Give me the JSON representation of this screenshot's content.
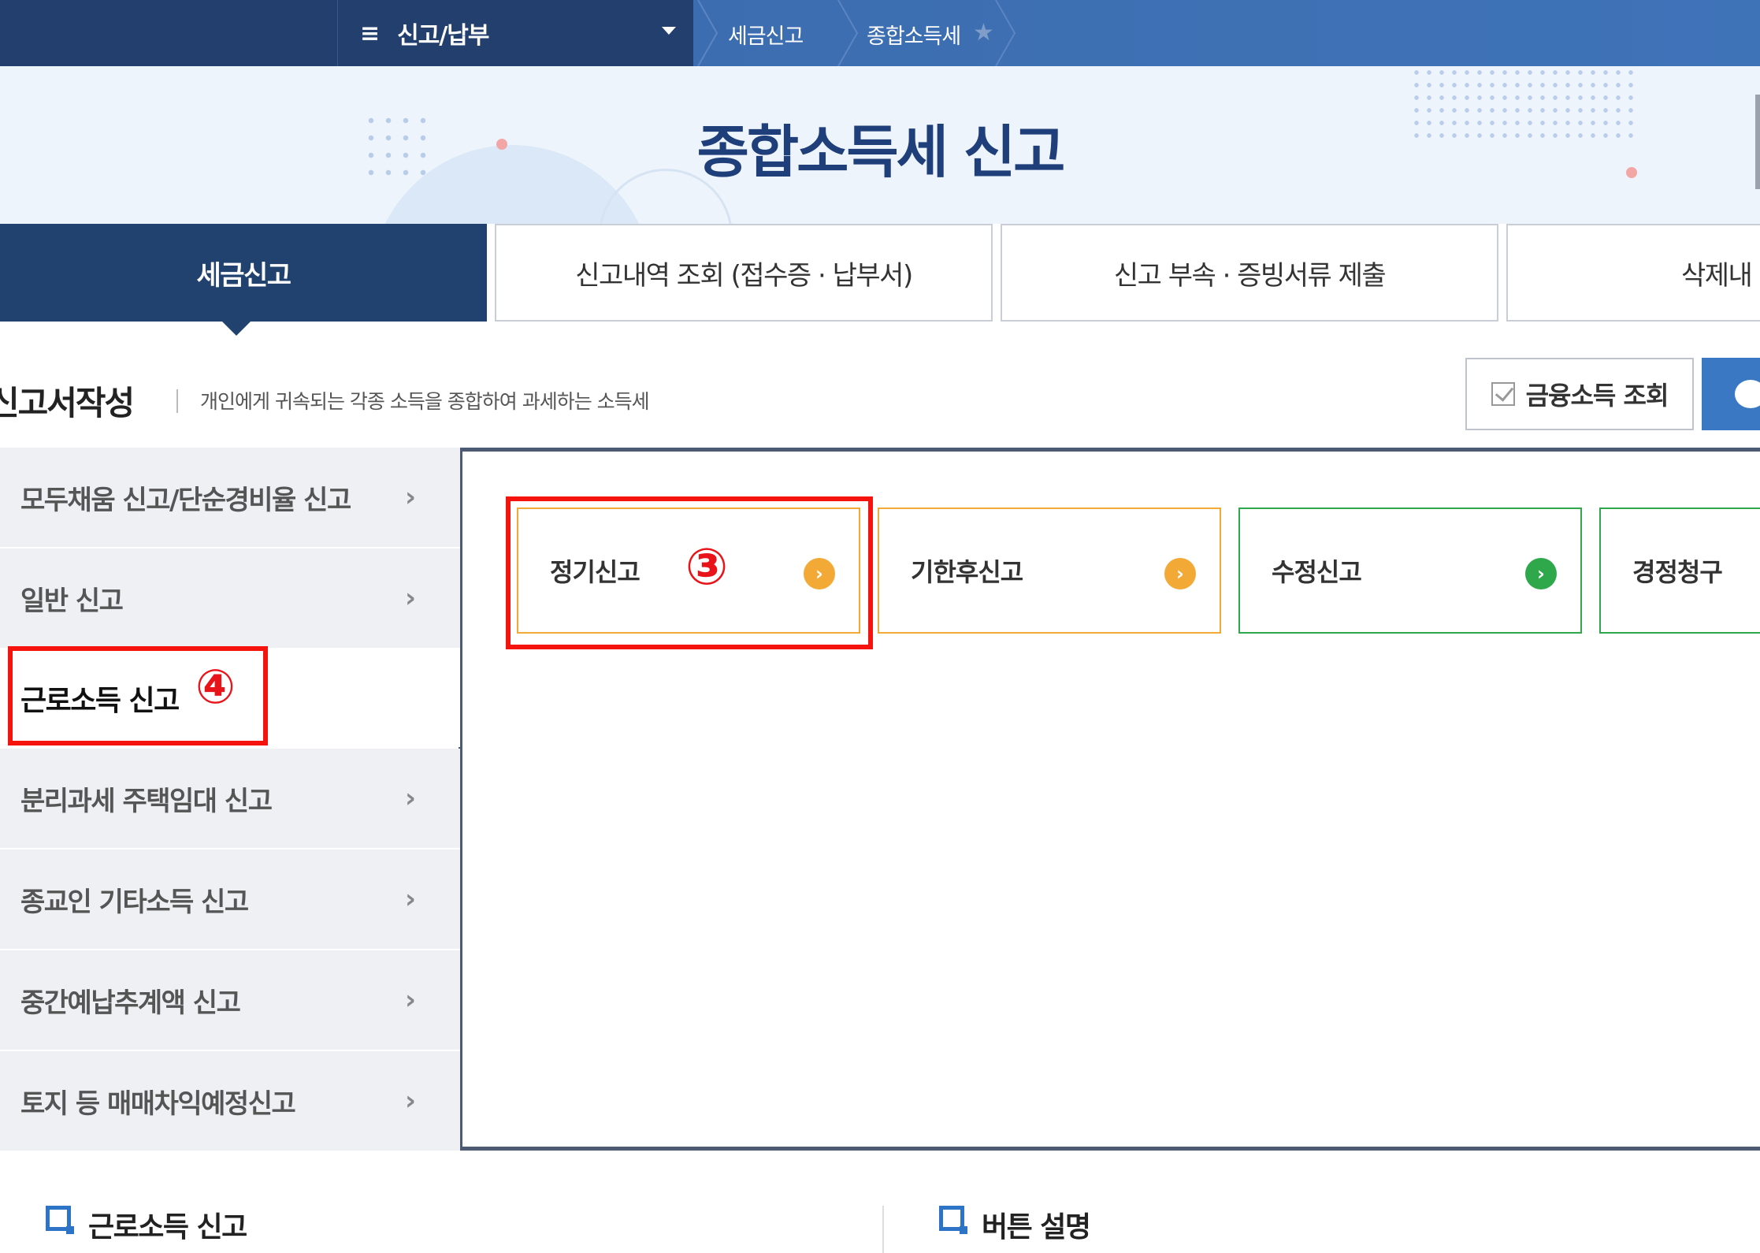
{
  "topnav": {
    "menu_icon": "≡",
    "menu_label": "신고/납부",
    "breadcrumbs": [
      "세금신고",
      "종합소득세"
    ]
  },
  "banner": {
    "title": "종합소득세 신고"
  },
  "tabs": [
    {
      "label": "세금신고",
      "active": true
    },
    {
      "label": "신고내역 조회 (접수증 · 납부서)",
      "active": false
    },
    {
      "label": "신고 부속 · 증빙서류 제출",
      "active": false
    },
    {
      "label": "삭제내",
      "active": false
    }
  ],
  "section": {
    "title": "신고서작성",
    "description": "개인에게 귀속되는 각종 소득을 종합하여 과세하는 소득세",
    "fin_button": "금융소득 조회"
  },
  "left_menu": [
    {
      "label": "모두채움 신고/단순경비율 신고"
    },
    {
      "label": "일반 신고"
    },
    {
      "label": "근로소득 신고",
      "active": true,
      "annotation": "④"
    },
    {
      "label": "분리과세 주택임대 신고"
    },
    {
      "label": "종교인 기타소득 신고"
    },
    {
      "label": "중간예납추계액 신고"
    },
    {
      "label": "토지 등 매매차익예정신고"
    }
  ],
  "cards": [
    {
      "label": "정기신고",
      "color": "#f3a935",
      "annotation": "③"
    },
    {
      "label": "기한후신고",
      "color": "#f3a935"
    },
    {
      "label": "수정신고",
      "color": "#2ea84b"
    },
    {
      "label": "경정청구",
      "color": "#2ea84b"
    }
  ],
  "bottom": {
    "left_title": "근로소득 신고",
    "right_title": "버튼 설명"
  }
}
